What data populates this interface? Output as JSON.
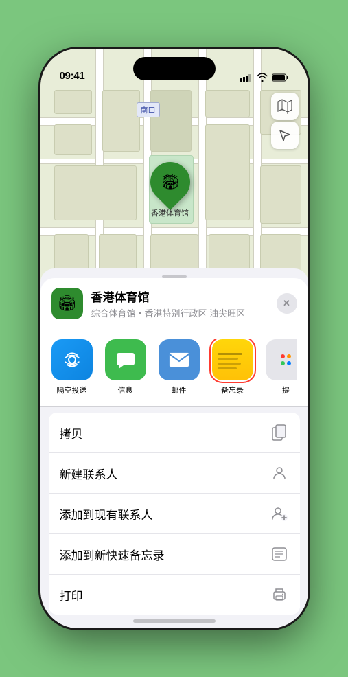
{
  "status_bar": {
    "time": "09:41",
    "location_arrow": true
  },
  "map": {
    "label_text": "南口",
    "pin_label": "香港体育馆"
  },
  "map_controls": {
    "map_icon": "🗺",
    "location_icon": "↗"
  },
  "location_header": {
    "name": "香港体育馆",
    "subtitle": "综合体育馆・香港特别行政区 油尖旺区",
    "close_label": "✕"
  },
  "share_items": [
    {
      "id": "airdrop",
      "label": "隔空投送",
      "type": "airdrop"
    },
    {
      "id": "messages",
      "label": "信息",
      "type": "messages"
    },
    {
      "id": "mail",
      "label": "邮件",
      "type": "mail"
    },
    {
      "id": "notes",
      "label": "备忘录",
      "type": "notes"
    },
    {
      "id": "more",
      "label": "提",
      "type": "more"
    }
  ],
  "action_items": [
    {
      "id": "copy",
      "label": "拷贝",
      "icon": "copy"
    },
    {
      "id": "new-contact",
      "label": "新建联系人",
      "icon": "person-add"
    },
    {
      "id": "add-contact",
      "label": "添加到现有联系人",
      "icon": "person-plus"
    },
    {
      "id": "quick-note",
      "label": "添加到新快速备忘录",
      "icon": "note"
    },
    {
      "id": "print",
      "label": "打印",
      "icon": "print"
    }
  ]
}
